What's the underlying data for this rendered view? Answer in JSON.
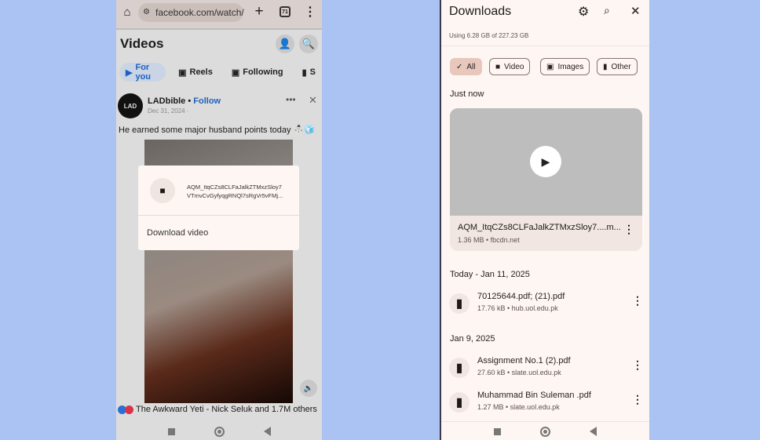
{
  "left_phone": {
    "url": "facebook.com/watch/",
    "tab_count": "71",
    "page_title": "Videos",
    "tabs": [
      {
        "label": "For you",
        "active": true
      },
      {
        "label": "Reels"
      },
      {
        "label": "Following"
      },
      {
        "label": "S"
      }
    ],
    "post": {
      "author": "LADbible",
      "separator": "•",
      "follow": "Follow",
      "date": "Dec 31, 2024 ·",
      "caption": "He earned some major husband points today ⛄🧊",
      "avatar_text": "LAD",
      "reactions": "The Awkward Yeti - Nick Seluk and 1.7M others"
    },
    "popup": {
      "filename_line1": "AQM_ItqCZs8CLFaJalkZTMxzSloy7",
      "filename_line2": "VTmvCvGyfyqgRNQl7sRgVr5vFMj...",
      "action": "Download video"
    }
  },
  "right_phone": {
    "title": "Downloads",
    "storage": "Using 6.28 GB of 227.23 GB",
    "filters": [
      {
        "label": "All",
        "selected": true,
        "icon": "check-icon"
      },
      {
        "label": "Video",
        "icon": "video-icon"
      },
      {
        "label": "Images",
        "icon": "image-icon"
      },
      {
        "label": "Other",
        "icon": "file-icon"
      }
    ],
    "just_now": {
      "header": "Just now",
      "name": "AQM_ItqCZs8CLFaJalkZTMxzSloy7....m...",
      "meta": "1.36 MB • fbcdn.net"
    },
    "sections": [
      {
        "header": "Today - Jan 11, 2025",
        "items": [
          {
            "name": "70125644.pdf; (21).pdf",
            "meta": "17.76 kB • hub.uol.edu.pk"
          }
        ]
      },
      {
        "header": "Jan 9, 2025",
        "items": [
          {
            "name": "Assignment No.1 (2).pdf",
            "meta": "27.60 kB • slate.uol.edu.pk"
          },
          {
            "name": "Muhammad Bin Suleman .pdf",
            "meta": "1.27 MB • slate.uol.edu.pk"
          }
        ]
      }
    ]
  },
  "colors": {
    "background": "#aac3f2",
    "accent_chip": "#e8c7bc",
    "link": "#1f5fbf"
  }
}
